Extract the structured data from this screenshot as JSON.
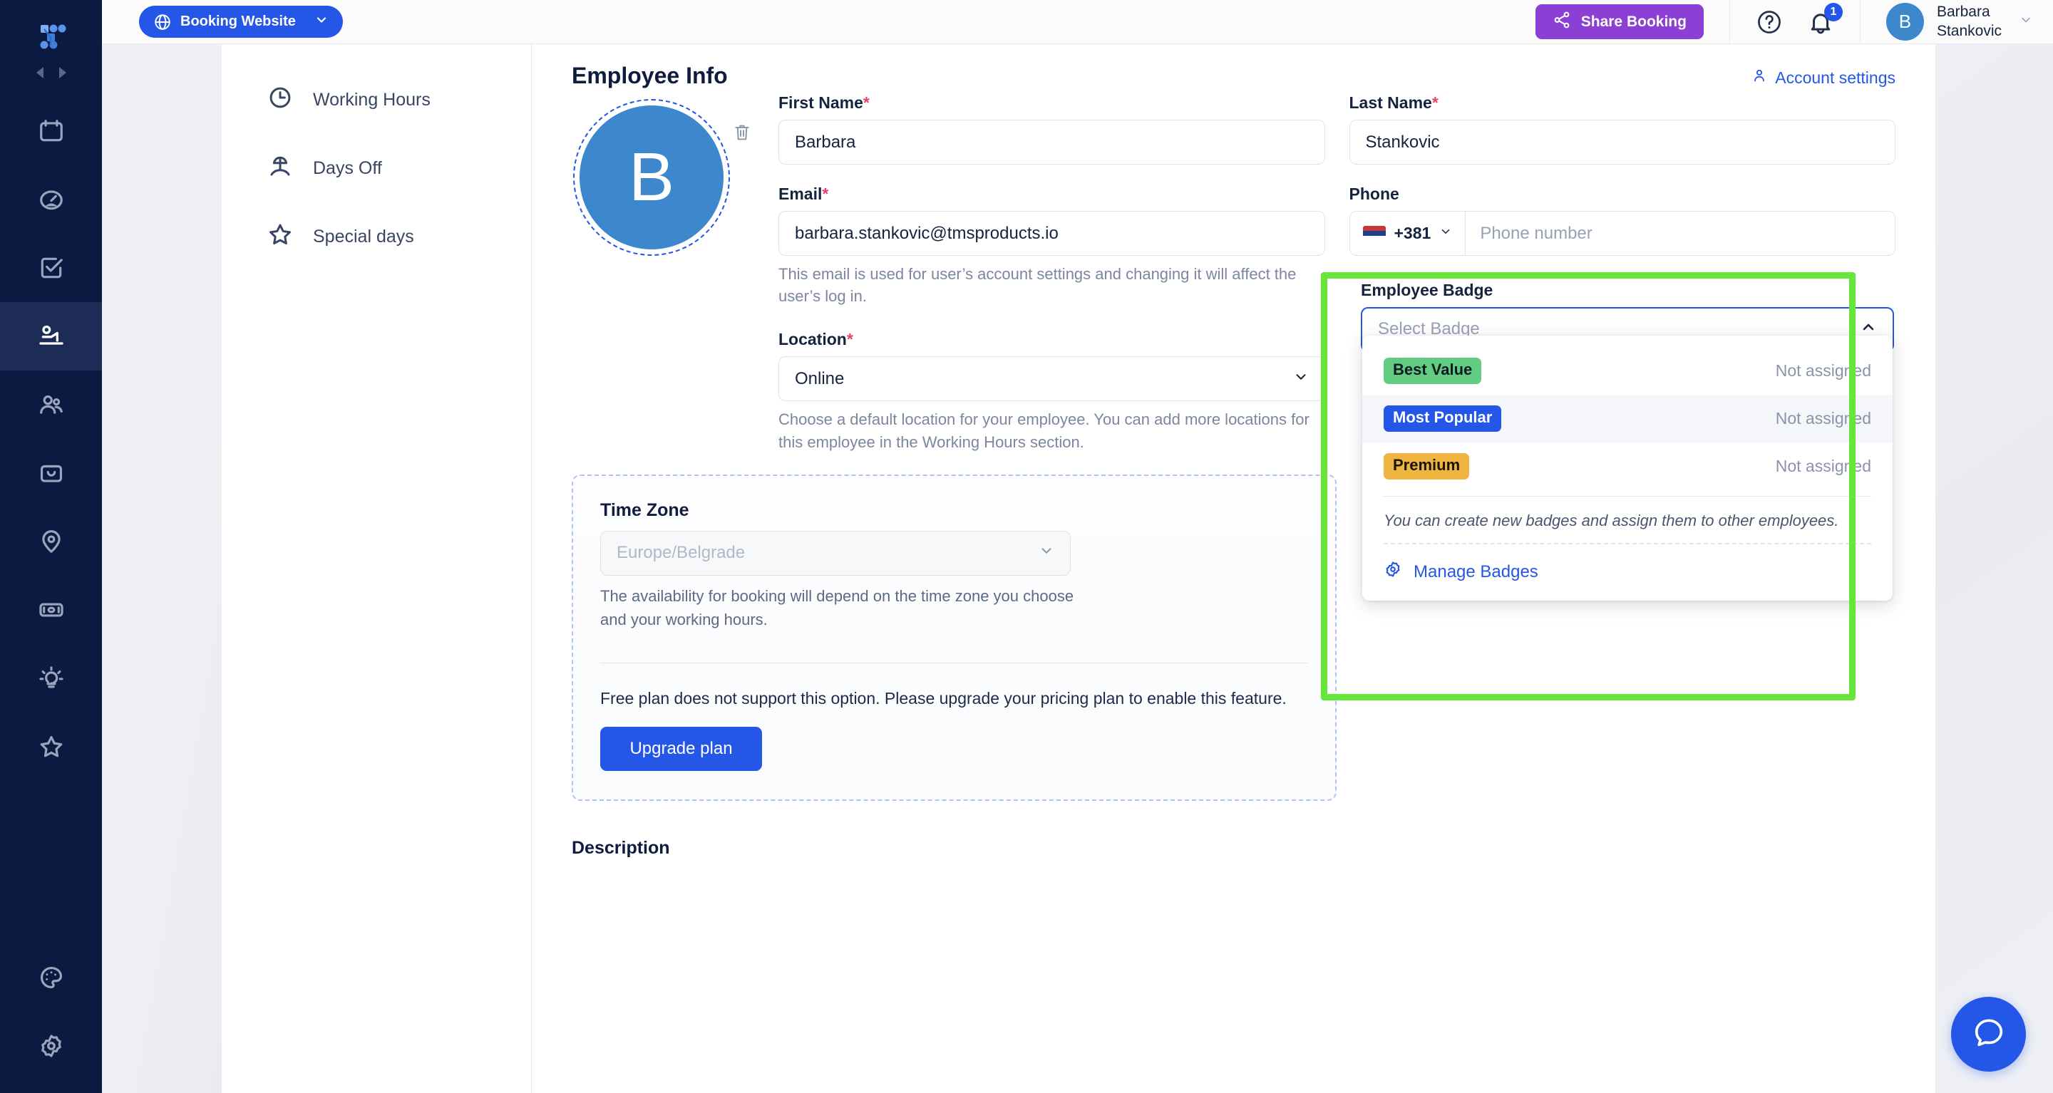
{
  "header": {
    "booking_button": "Booking Website",
    "share_button": "Share Booking",
    "notification_count": "1",
    "user_first": "Barbara",
    "user_last": "Stankovic",
    "user_initial": "B",
    "icons": [
      "globe-icon",
      "chevron-down-icon",
      "share-icon",
      "help-circle-icon",
      "bell-icon",
      "chevron-down-icon"
    ]
  },
  "rail": {
    "logo": "app-logo",
    "items": [
      {
        "icon": "calendar-icon",
        "active": false
      },
      {
        "icon": "dashboard-gauge-icon",
        "active": false
      },
      {
        "icon": "checkbox-tasks-icon",
        "active": false
      },
      {
        "icon": "employees-icon",
        "active": true
      },
      {
        "icon": "customers-icon",
        "active": false
      },
      {
        "icon": "services-box-icon",
        "active": false
      },
      {
        "icon": "locations-pin-icon",
        "active": false
      },
      {
        "icon": "payments-cash-icon",
        "active": false
      },
      {
        "icon": "insights-bulb-icon",
        "active": false
      },
      {
        "icon": "features-star-icon",
        "active": false
      }
    ],
    "bottom_items": [
      {
        "icon": "customize-palette-icon"
      },
      {
        "icon": "settings-gear-icon"
      }
    ]
  },
  "subnav": {
    "items": [
      {
        "label": "Working Hours",
        "icon": "clock-icon"
      },
      {
        "label": "Days Off",
        "icon": "umbrella-icon"
      },
      {
        "label": "Special days",
        "icon": "star-icon"
      }
    ]
  },
  "main": {
    "page_title": "Employee Info",
    "account_settings_link": "Account settings",
    "avatar_initial": "B",
    "delete_avatar_icon": "trash-icon",
    "first_name": {
      "label": "First Name",
      "required": "*",
      "value": "Barbara"
    },
    "last_name": {
      "label": "Last Name",
      "required": "*",
      "value": "Stankovic"
    },
    "email": {
      "label": "Email",
      "required": "*",
      "value": "barbara.stankovic@tmsproducts.io",
      "hint": "This email is used for user’s account settings and changing it will affect the user’s log in."
    },
    "phone": {
      "label": "Phone",
      "country_code": "+381",
      "flag": "rs-flag",
      "placeholder": "Phone number"
    },
    "location": {
      "label": "Location",
      "required": "*",
      "value": "Online",
      "hint": "Choose a default location for your employee. You can add more locations for this employee in the Working Hours section."
    },
    "time_zone": {
      "label": "Time Zone",
      "placeholder": "Europe/Belgrade",
      "hint": "The availability for booking will depend on the time zone you choose and your working hours."
    },
    "upsell": {
      "text": "Free plan does not support this option. Please upgrade your pricing plan to enable this feature.",
      "button": "Upgrade plan"
    },
    "description_title": "Description"
  },
  "badge": {
    "label": "Employee Badge",
    "placeholder": "Select Badge",
    "expanded": true,
    "chevron_icon": "chevron-up-icon",
    "options": [
      {
        "label": "Best Value",
        "status": "Not assigned",
        "bg": "#63cc83",
        "fg": "#0f1c1f",
        "hover": false
      },
      {
        "label": "Most Popular",
        "status": "Not assigned",
        "bg": "#2456e8",
        "fg": "#ffffff",
        "hover": true
      },
      {
        "label": "Premium",
        "status": "Not assigned",
        "bg": "#f0b440",
        "fg": "#1a1405",
        "hover": false
      }
    ],
    "note": "You can create new badges and assign them to other employees.",
    "manage_link": "Manage Badges",
    "manage_icon": "gear-icon",
    "highlight_color": "#66e639"
  },
  "help_fab": {
    "icon": "chat-bubble-icon"
  }
}
